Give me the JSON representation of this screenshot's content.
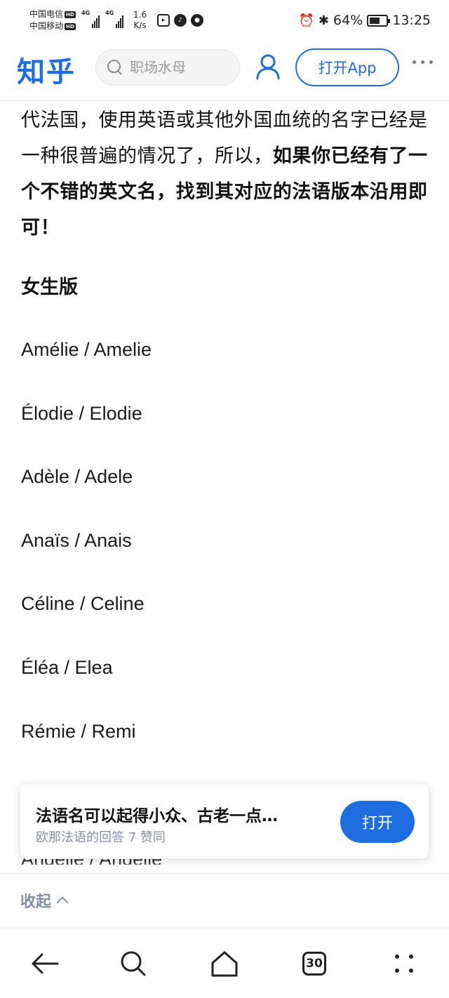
{
  "status_bar": {
    "carrier_1": "中国电信",
    "carrier_2": "中国移动",
    "net_1": "4G",
    "net_2": "4G",
    "speed_value": "1.6",
    "speed_unit": "K/s",
    "battery": "64%",
    "battery_level": 0.64,
    "time": "13:25"
  },
  "header": {
    "logo": "知乎",
    "search_placeholder": "职场水母",
    "open_app_label": "打开App"
  },
  "article": {
    "para_plain": "代法国，使用英语或其他外国血统的名字已经是一种很普遍的情况了，所以，",
    "para_bold": "如果你已经有了一个不错的英文名，找到其对应的法语版本沿用即可！",
    "subheading": "女生版",
    "names": [
      "Amélie / Amelie",
      "Élodie / Elodie",
      "Adèle / Adele",
      "Anaïs / Anais",
      "Céline / Celine",
      "Éléa / Elea",
      "Rémie / Remi"
    ],
    "partially_hidden_name": "Angèlle / Angèlle"
  },
  "card": {
    "title": "法语名可以起得小众、古老一点…",
    "meta": "欧那法语的回答 7 赞同",
    "open_label": "打开"
  },
  "collapse": {
    "label": "收起"
  },
  "bottom_nav": {
    "tabs_count": "30"
  }
}
